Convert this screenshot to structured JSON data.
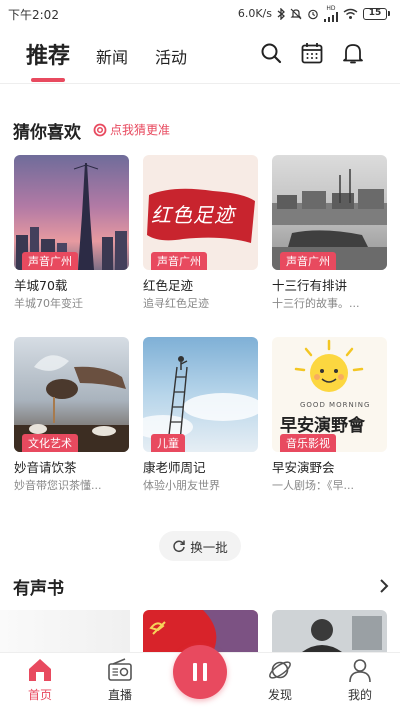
{
  "status": {
    "time": "下午2:02",
    "net_speed": "6.0K/s",
    "signal_label": "HD",
    "battery": "15"
  },
  "header": {
    "tabs": [
      {
        "label": "推荐"
      },
      {
        "label": "新闻"
      },
      {
        "label": "活动"
      }
    ]
  },
  "recommend": {
    "title": "猜你喜欢",
    "subtitle": "点我猜更准",
    "cards": [
      {
        "tag": "声音广州",
        "name": "羊城70载",
        "desc": "羊城70年变迁"
      },
      {
        "tag": "声音广州",
        "name": "红色足迹",
        "desc": "追寻红色足迹",
        "thumb_text": "红色足迹"
      },
      {
        "tag": "声音广州",
        "name": "十三行有排讲",
        "desc": "十三行的故事。..."
      },
      {
        "tag": "文化艺术",
        "name": "妙音请饮茶",
        "desc": "妙音带您识茶懂..."
      },
      {
        "tag": "儿童",
        "name": "康老师周记",
        "desc": "体验小朋友世界"
      },
      {
        "tag": "音乐影视",
        "name": "早安演野会",
        "desc": "一人剧场：《早...",
        "thumb_text": "早安演野會",
        "thumb_caption": "GOOD MORNING"
      }
    ],
    "refresh_label": "换一批"
  },
  "audiobook": {
    "title": "有声书"
  },
  "tabbar": {
    "items": [
      {
        "label": "首页"
      },
      {
        "label": "直播"
      },
      {
        "label": "发现"
      },
      {
        "label": "我的"
      }
    ]
  },
  "colors": {
    "accent": "#e84a5f"
  }
}
